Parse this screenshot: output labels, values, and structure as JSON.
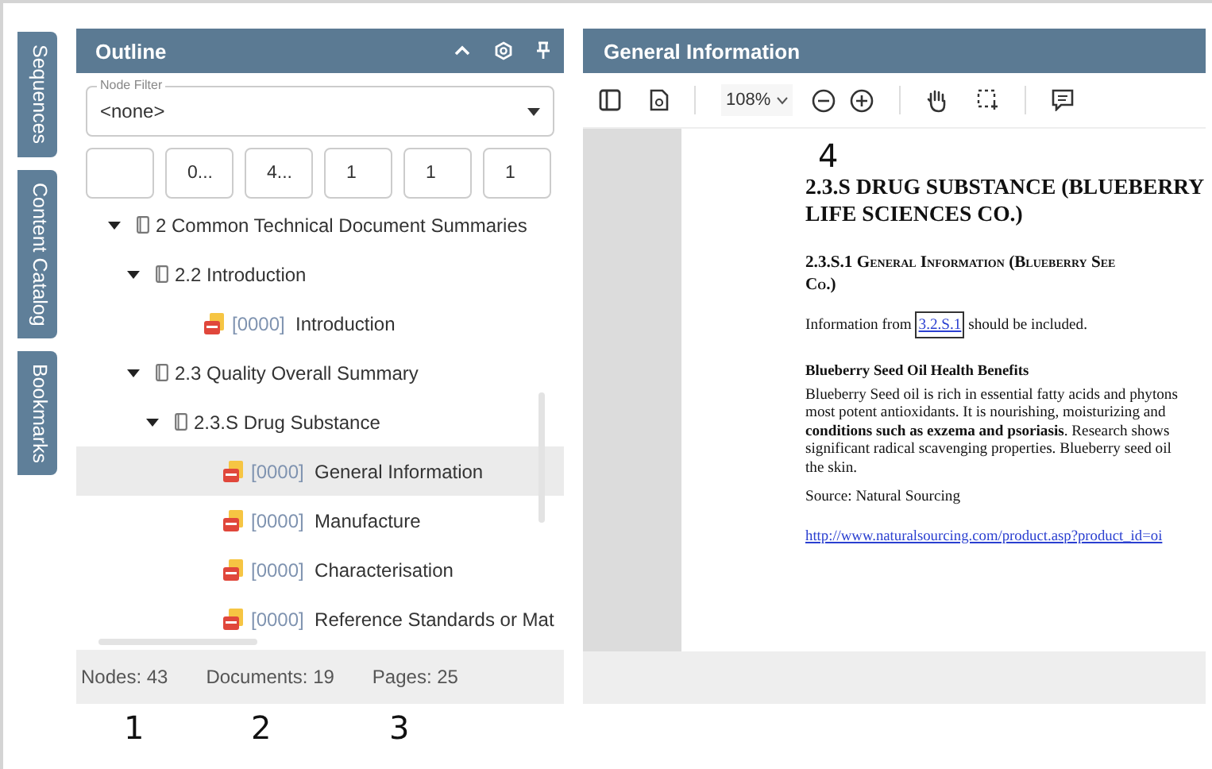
{
  "side_tabs": [
    {
      "label": "Sequences"
    },
    {
      "label": "Content Catalog"
    },
    {
      "label": "Bookmarks"
    }
  ],
  "outline": {
    "title": "Outline",
    "node_filter": {
      "label": "Node Filter",
      "value": "<none>"
    },
    "column_filters": [
      {
        "kind": "empty"
      },
      {
        "kind": "text",
        "value": "0..."
      },
      {
        "kind": "text",
        "value": "4..."
      },
      {
        "kind": "text",
        "value": "1"
      },
      {
        "kind": "text",
        "value": "1"
      },
      {
        "kind": "text",
        "value": "1"
      }
    ],
    "tree": [
      {
        "kind": "folder",
        "label": "2 Common Technical Document Summaries",
        "expanded": true,
        "selected": false,
        "children": [
          {
            "kind": "folder",
            "label": "2.2 Introduction",
            "expanded": true,
            "selected": false,
            "children": [
              {
                "kind": "document",
                "code": "[0000]",
                "label": "Introduction",
                "selected": false
              }
            ]
          },
          {
            "kind": "folder",
            "label": "2.3 Quality Overall Summary",
            "expanded": true,
            "selected": false,
            "children": [
              {
                "kind": "folder",
                "label": "2.3.S Drug Substance",
                "expanded": true,
                "selected": false,
                "children": [
                  {
                    "kind": "document",
                    "code": "[0000]",
                    "label": "General Information",
                    "selected": true
                  },
                  {
                    "kind": "document",
                    "code": "[0000]",
                    "label": "Manufacture",
                    "selected": false
                  },
                  {
                    "kind": "document",
                    "code": "[0000]",
                    "label": "Characterisation",
                    "selected": false
                  },
                  {
                    "kind": "document",
                    "code": "[0000]",
                    "label": "Reference Standards or Mat",
                    "selected": false
                  }
                ]
              }
            ]
          }
        ]
      }
    ],
    "status": [
      "Nodes: 43",
      "Documents: 19",
      "Pages: 25"
    ]
  },
  "viewer": {
    "title": "General Information",
    "zoom": "108%",
    "document": {
      "heading": [
        "2.3.S DRUG SUBSTANCE (BLUEBERRY",
        "LIFE SCIENCES CO.)"
      ],
      "subheading": [
        "2.3.S.1 General Information (Blueberry See",
        "Co.)"
      ],
      "reference": {
        "before": "Information from",
        "link": "3.2.S.1",
        "after": "should be included."
      },
      "section_title": "Blueberry Seed Oil Health Benefits",
      "body_lines": [
        "Blueberry Seed oil is rich in essential fatty acids and phytons",
        "most potent antioxidants. It is nourishing, moisturizing and",
        "**conditions such as exzema and psoriasis**. Research shows",
        "significant radical scavenging properties. Blueberry seed oil",
        "the skin."
      ],
      "source": "Source: Natural Sourcing",
      "url": "http://www.naturalsourcing.com/product.asp?product_id=oi"
    }
  },
  "callouts": [
    "1",
    "2",
    "3",
    "4"
  ]
}
